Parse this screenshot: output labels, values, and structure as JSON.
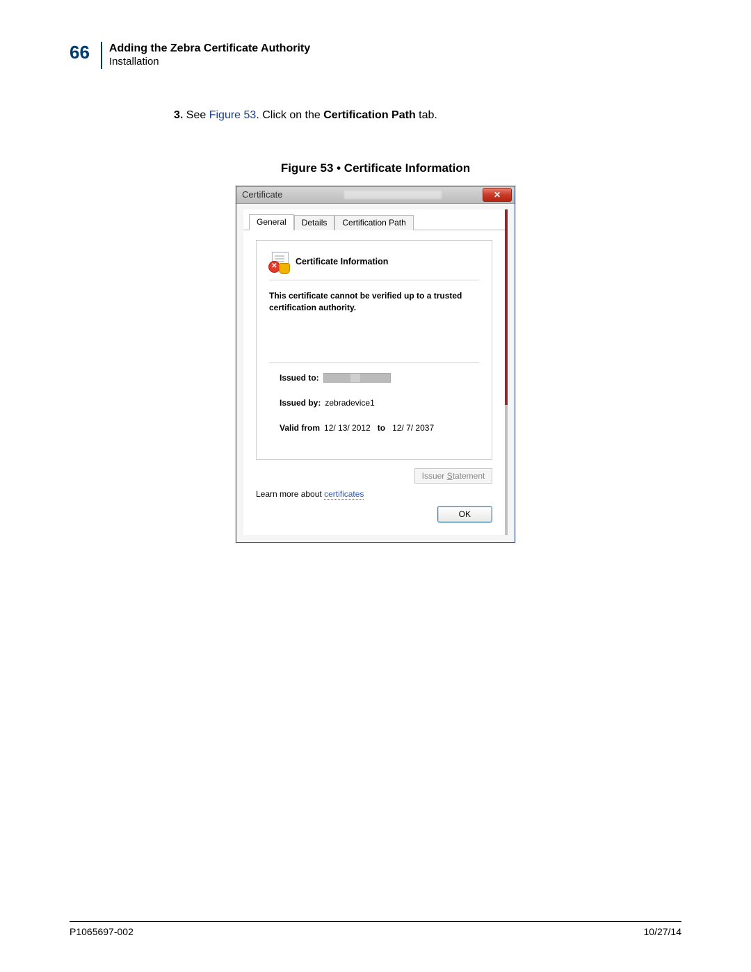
{
  "header": {
    "page_number": "66",
    "title": "Adding the Zebra Certificate Authority",
    "subtitle": "Installation"
  },
  "step": {
    "number": "3.",
    "prefix": "See ",
    "figure_ref": "Figure 53",
    "mid": ". Click on the ",
    "bold_target": "Certification Path",
    "suffix": " tab."
  },
  "figure_caption": "Figure 53 • Certificate Information",
  "dialog": {
    "title": "Certificate",
    "tabs": {
      "general": "General",
      "details": "Details",
      "certpath": "Certification Path"
    },
    "cert_heading": "Certificate Information",
    "warning": "This certificate cannot be verified up to a trusted certification authority.",
    "issued_to_label": "Issued to:",
    "issued_by_label": "Issued by:",
    "issued_by_value": "zebradevice1",
    "valid_from_label": "Valid from",
    "valid_from_value": "12/ 13/ 2012",
    "valid_to_label": "to",
    "valid_to_value": "12/ 7/ 2037",
    "issuer_button_prefix": "Issuer ",
    "issuer_button_underline": "S",
    "issuer_button_suffix": "tatement",
    "learn_prefix": "Learn more about ",
    "learn_link": "certificates",
    "ok": "OK"
  },
  "footer": {
    "doc_id": "P1065697-002",
    "date": "10/27/14"
  }
}
